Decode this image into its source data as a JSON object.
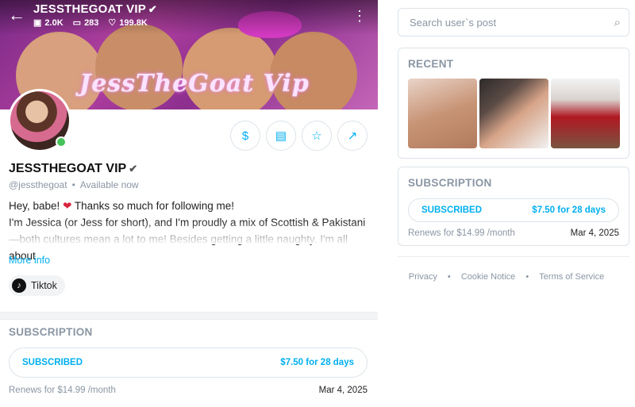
{
  "header": {
    "title": "JESSTHEGOAT VIP",
    "stats": {
      "images": "2.0K",
      "videos": "283",
      "likes": "199.8K"
    }
  },
  "banner": {
    "logo_text": "JessTheGoat Vip"
  },
  "profile": {
    "name": "JESSTHEGOAT VIP",
    "handle": "@jessthegoat",
    "status": "Available now",
    "bio_line1_a": "Hey, babe!",
    "bio_line1_b": "Thanks so much for following me!",
    "bio_line2": "I'm Jessica (or Jess for short), and I'm proudly a mix of Scottish & Pakistani—both cultures mean a lot to me! Besides getting a little naughty, I'm all about",
    "more_info": "More info",
    "social_label": "Tiktok"
  },
  "subscription_main": {
    "title": "SUBSCRIPTION",
    "status": "SUBSCRIBED",
    "price": "$7.50 for 28 days",
    "renews": "Renews for $14.99 /month",
    "date": "Mar 4, 2025"
  },
  "sidebar": {
    "search_placeholder": "Search user`s post",
    "recent_title": "RECENT",
    "subscription": {
      "title": "SUBSCRIPTION",
      "status": "SUBSCRIBED",
      "price": "$7.50 for 28 days",
      "renews": "Renews for $14.99 /month",
      "date": "Mar 4, 2025"
    },
    "footer": {
      "privacy": "Privacy",
      "cookie": "Cookie Notice",
      "terms": "Terms of Service"
    }
  },
  "colors": {
    "accent": "#00aff0",
    "muted": "#8a96a3",
    "online": "#46c35a"
  }
}
